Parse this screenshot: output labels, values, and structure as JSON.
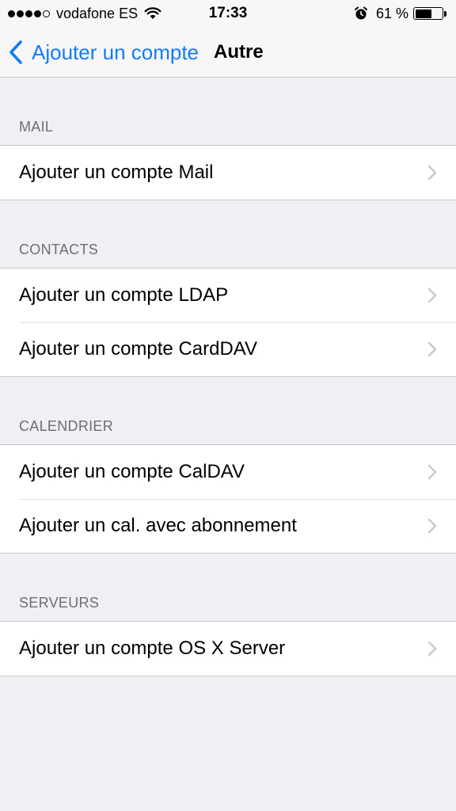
{
  "status_bar": {
    "carrier": "vodafone ES",
    "time": "17:33",
    "battery_percent": "61 %",
    "battery_level": 0.61,
    "icons": [
      "signal-dots",
      "wifi-icon",
      "alarm-icon",
      "battery-icon"
    ]
  },
  "nav": {
    "back_label": "Ajouter un compte",
    "title": "Autre",
    "accent_color": "#127cf8"
  },
  "sections": {
    "mail": {
      "header": "MAIL",
      "items": [
        "Ajouter un compte Mail"
      ]
    },
    "contacts": {
      "header": "CONTACTS",
      "items": [
        "Ajouter un compte LDAP",
        "Ajouter un compte CardDAV"
      ]
    },
    "calendar": {
      "header": "CALENDRIER",
      "items": [
        "Ajouter un compte CalDAV",
        "Ajouter un cal. avec abonnement"
      ]
    },
    "servers": {
      "header": "SERVEURS",
      "items": [
        "Ajouter un compte OS X Server"
      ]
    }
  }
}
